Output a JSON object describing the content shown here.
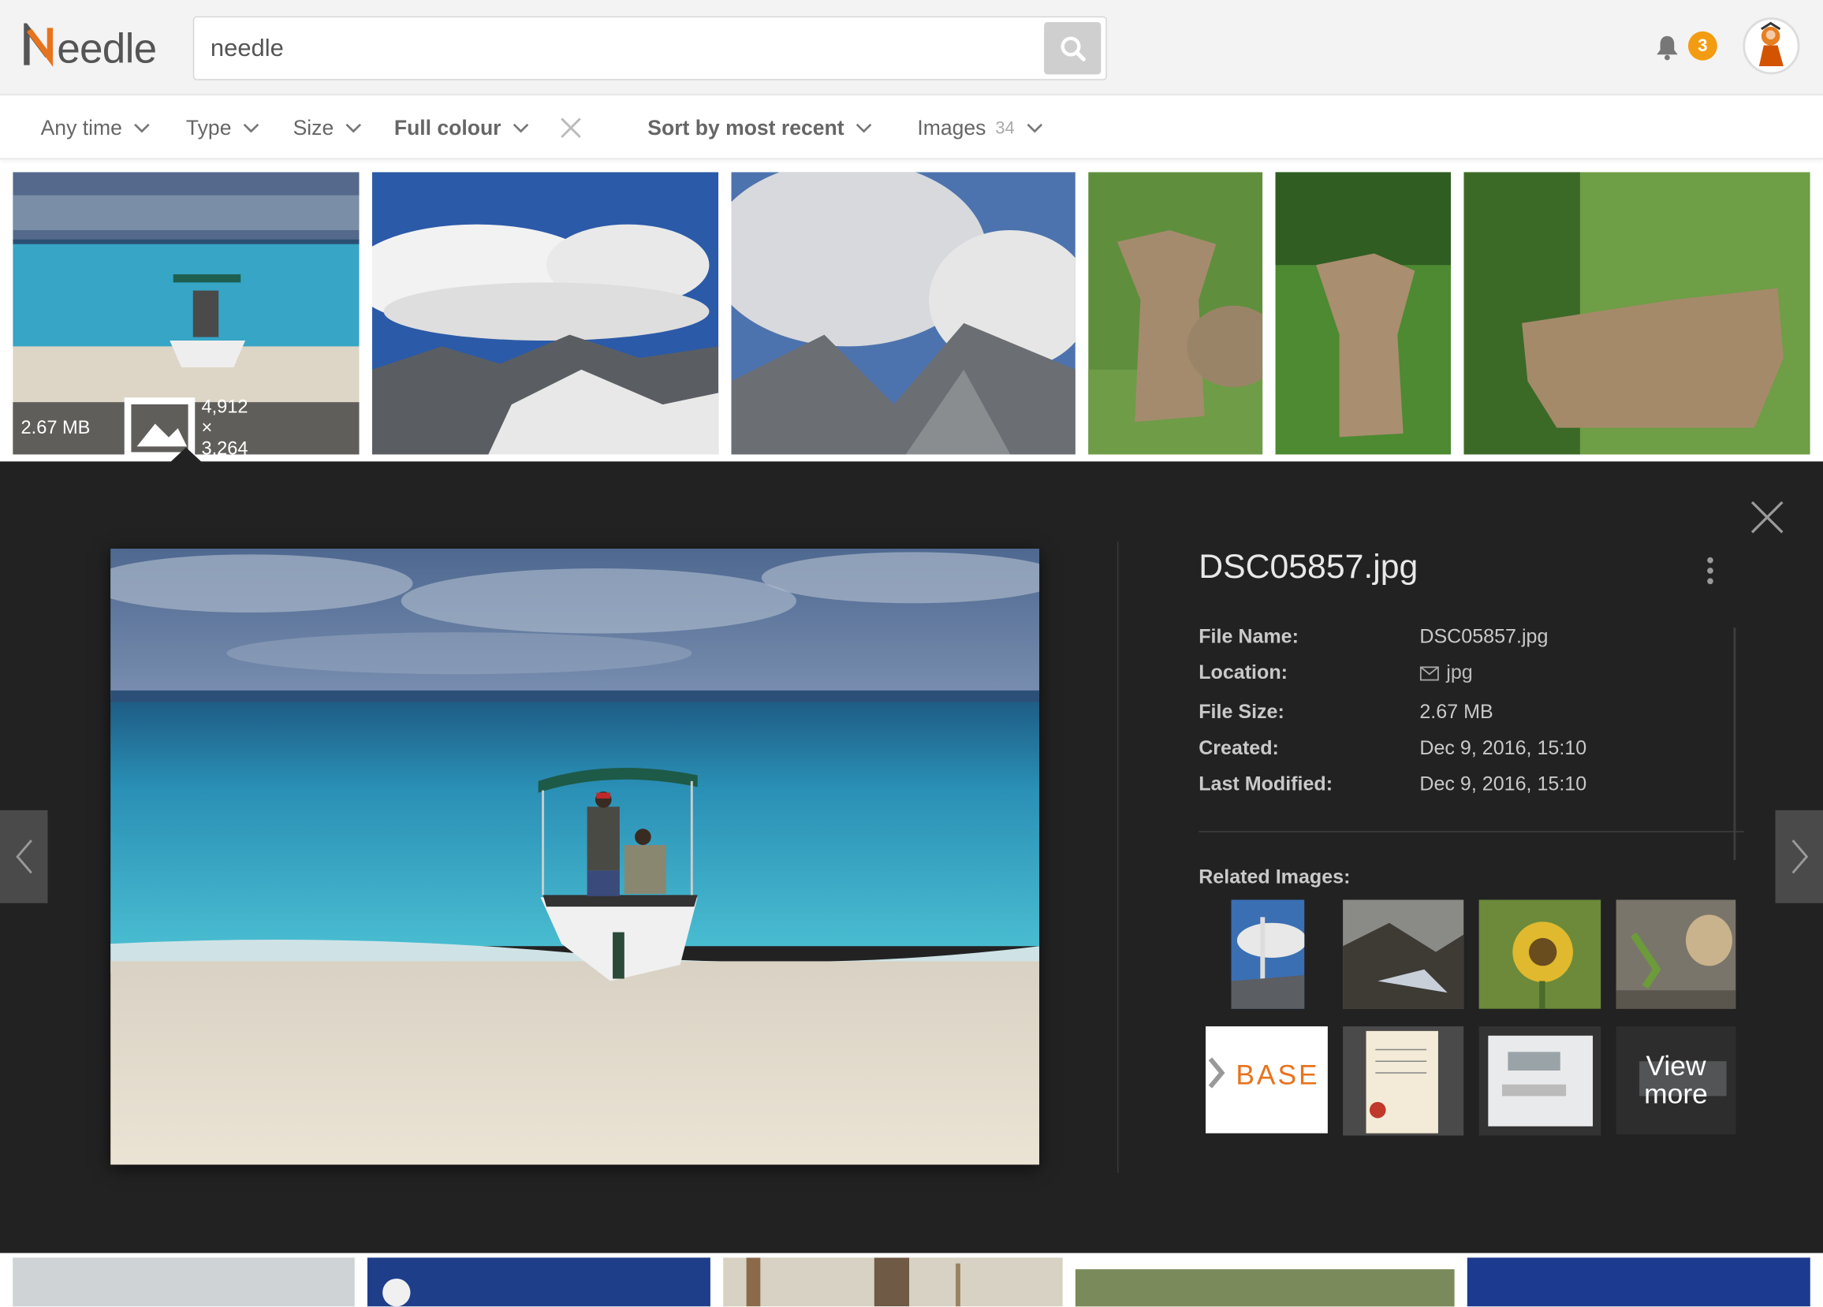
{
  "header": {
    "logo_text": "Needle",
    "search_value": "needle",
    "notification_count": "3"
  },
  "filters": [
    {
      "label": "Any time"
    },
    {
      "label": "Type"
    },
    {
      "label": "Size"
    },
    {
      "label": "Full colour"
    },
    {
      "label": "Sort by most recent"
    },
    {
      "label": "Images",
      "count": "34"
    }
  ],
  "selected_thumb": {
    "size": "2.67 MB",
    "dimensions": "4,912 × 3,264"
  },
  "detail": {
    "title": "DSC05857.jpg",
    "fields": [
      {
        "label": "File Name:",
        "value": "DSC05857.jpg"
      },
      {
        "label": "Location:",
        "value": "jpg"
      },
      {
        "label": "File Size:",
        "value": "2.67 MB"
      },
      {
        "label": "Created:",
        "value": "Dec 9, 2016, 15:10"
      },
      {
        "label": "Last Modified:",
        "value": "Dec 9, 2016, 15:10"
      }
    ],
    "related_label": "Related Images:",
    "related_base_text": "BASE",
    "view_more_line1": "View",
    "view_more_line2": "more"
  },
  "colors": {
    "accent_badge": "#f39c12",
    "detail_bg": "#222223",
    "header_bg": "#f3f3f3"
  }
}
